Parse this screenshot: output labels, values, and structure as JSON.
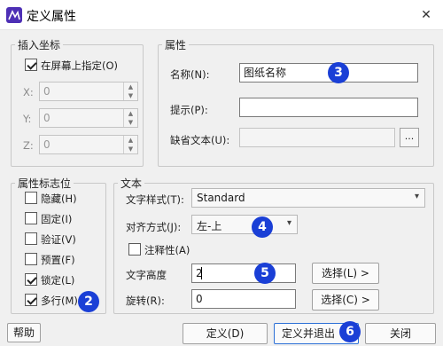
{
  "window": {
    "title": "定义属性",
    "close_glyph": "✕",
    "icon": "app-icon"
  },
  "insert_point": {
    "legend": "插入坐标",
    "on_screen_label": "在屏幕上指定(O)",
    "on_screen_checked": true,
    "x_label": "X:",
    "x_value": "0",
    "y_label": "Y:",
    "y_value": "0",
    "z_label": "Z:",
    "z_value": "0"
  },
  "attribute": {
    "legend": "属性",
    "name_label": "名称(N):",
    "name_value": "图纸名称",
    "prompt_label": "提示(P):",
    "prompt_value": "",
    "default_label": "缺省文本(U):",
    "default_value": "",
    "browse_label": "..."
  },
  "flags": {
    "legend": "属性标志位",
    "items": [
      {
        "label": "隐藏(H)",
        "checked": false
      },
      {
        "label": "固定(I)",
        "checked": false
      },
      {
        "label": "验证(V)",
        "checked": false
      },
      {
        "label": "预置(F)",
        "checked": false
      },
      {
        "label": "锁定(L)",
        "checked": true
      },
      {
        "label": "多行(M)",
        "checked": true
      }
    ]
  },
  "text": {
    "legend": "文本",
    "style_label": "文字样式(T):",
    "style_value": "Standard",
    "align_label": "对齐方式(J):",
    "align_value": "左-上",
    "annotative_label": "注释性(A)",
    "annotative_checked": false,
    "height_label": "文字高度",
    "height_value": "2",
    "height_pick_label": "选择(L) >",
    "rotation_label": "旋转(R):",
    "rotation_value": "0",
    "rotation_pick_label": "选择(C) >"
  },
  "footer": {
    "help_label": "帮助",
    "define_label": "定义(D)",
    "define_exit_label": "定义并退出",
    "close_label": "关闭"
  },
  "badges": [
    "2",
    "3",
    "4",
    "5",
    "6"
  ],
  "colors": {
    "badge": "#1a3fd6",
    "app_icon": "#4d2fb5",
    "primary_border": "#2b6fd6"
  }
}
